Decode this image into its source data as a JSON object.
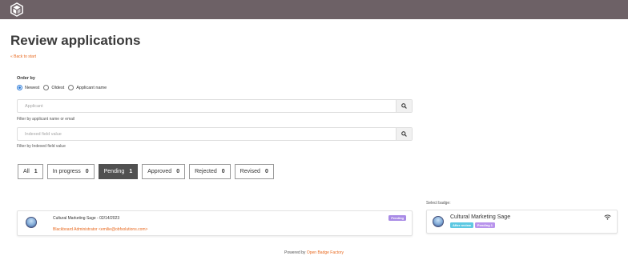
{
  "page": {
    "title": "Review applications",
    "back_link": "« Back to start"
  },
  "order": {
    "label": "Order by",
    "options": [
      {
        "label": "Newest",
        "selected": true
      },
      {
        "label": "Oldest",
        "selected": false
      },
      {
        "label": "Applicant name",
        "selected": false
      }
    ]
  },
  "filters": {
    "applicant": {
      "placeholder": "Applicant",
      "value": "",
      "help": "Filter by applicant name or email"
    },
    "indexed": {
      "placeholder": "Indexed field value",
      "value": "",
      "help": "Filter by Indexed field value"
    }
  },
  "status_tabs": [
    {
      "label": "All",
      "count": "1",
      "active": false
    },
    {
      "label": "In progress",
      "count": "0",
      "active": false
    },
    {
      "label": "Pending",
      "count": "1",
      "active": true
    },
    {
      "label": "Approved",
      "count": "0",
      "active": false
    },
    {
      "label": "Rejected",
      "count": "0",
      "active": false
    },
    {
      "label": "Revised",
      "count": "0",
      "active": false
    }
  ],
  "application": {
    "title": "Cultural Marketing Sage - 02/14/2023",
    "applicant": "Blackboard Administrator <emilie@obfsolutions.com>",
    "status": "Pending"
  },
  "badge_select": {
    "label": "Select badge:",
    "badge_name": "Cultural Marketing Sage",
    "tags": [
      "After review",
      "Pending 1"
    ]
  },
  "footer": {
    "prefix": "Powered by",
    "link": "Open Badge Factory"
  },
  "colors": {
    "accent": "#e8691f",
    "topbar": "#6d6166",
    "status_badge": "#a98be6",
    "after_review_tag": "#5dc8e2",
    "pending_tag": "#b994ec",
    "active_tab": "#505050"
  },
  "icons": {
    "logo": "badge-cube-icon",
    "search": "magnifier-icon",
    "signal": "wifi-signal-icon"
  }
}
